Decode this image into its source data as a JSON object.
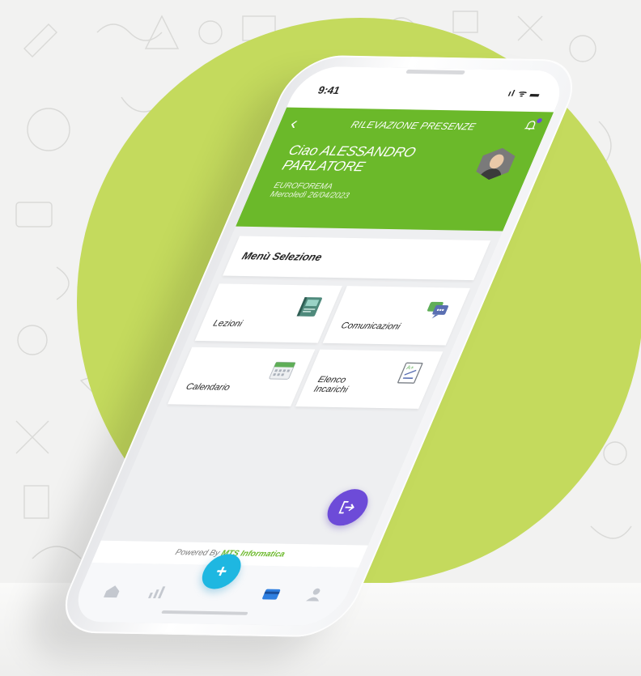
{
  "status": {
    "time": "9:41",
    "icons": "ıl ᯤ ▬"
  },
  "header": {
    "title": "RILEVAZIONE PRESENZE",
    "greeting": "Ciao ALESSANDRO PARLATORE",
    "school": "EUROFOREMA",
    "date": "Mercoledì 26/04/2023"
  },
  "menu": {
    "title": "Menù Selezione",
    "tiles": [
      {
        "label": "Lezioni",
        "icon": "book-icon"
      },
      {
        "label": "Comunicazioni",
        "icon": "chat-icon"
      },
      {
        "label": "Calendario",
        "icon": "calendar-icon"
      },
      {
        "label_line1": "Elenco",
        "label_line2": "Incarichi",
        "icon": "grade-sheet-icon"
      }
    ]
  },
  "footer": {
    "powered_prefix": "Powered By",
    "powered_brand": "MTS Informatica"
  },
  "tabbar": {
    "plus_label": "+"
  },
  "colors": {
    "accent_green": "#6bb92a",
    "circle_green": "#c4da5d",
    "fab_purple": "#6d4bd8",
    "fab_blue": "#1eb7e1"
  }
}
